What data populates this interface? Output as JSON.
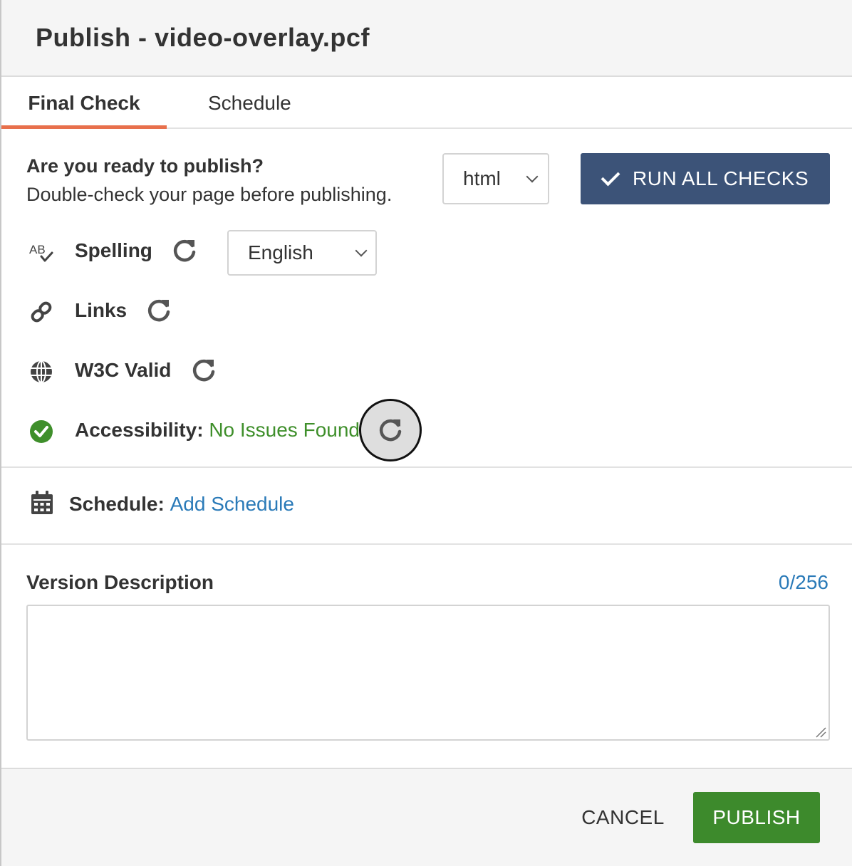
{
  "dialog": {
    "title": "Publish - video-overlay.pcf"
  },
  "tabs": [
    {
      "label": "Final Check",
      "active": true
    },
    {
      "label": "Schedule",
      "active": false
    }
  ],
  "final_check": {
    "heading": "Are you ready to publish?",
    "subheading": "Double-check your page before publishing.",
    "format_select": {
      "value": "html"
    },
    "run_all_label": "RUN ALL CHECKS",
    "checks": {
      "spelling": {
        "label": "Spelling",
        "icon": "spellcheck-icon",
        "language": "English"
      },
      "links": {
        "label": "Links",
        "icon": "link-icon"
      },
      "w3c": {
        "label": "W3C Valid",
        "icon": "globe-icon"
      },
      "accessibility": {
        "label": "Accessibility:",
        "status": "No Issues Found",
        "icon": "check-circle-icon"
      }
    }
  },
  "schedule": {
    "label": "Schedule:",
    "link": "Add Schedule"
  },
  "version_description": {
    "label": "Version Description",
    "counter": "0/256",
    "value": ""
  },
  "footer": {
    "cancel_label": "CANCEL",
    "publish_label": "PUBLISH"
  },
  "colors": {
    "tab_accent": "#e8704c",
    "run_button": "#3c5378",
    "publish_button": "#3d8a2c",
    "success": "#3f8f2b",
    "link": "#2a7ab8"
  }
}
